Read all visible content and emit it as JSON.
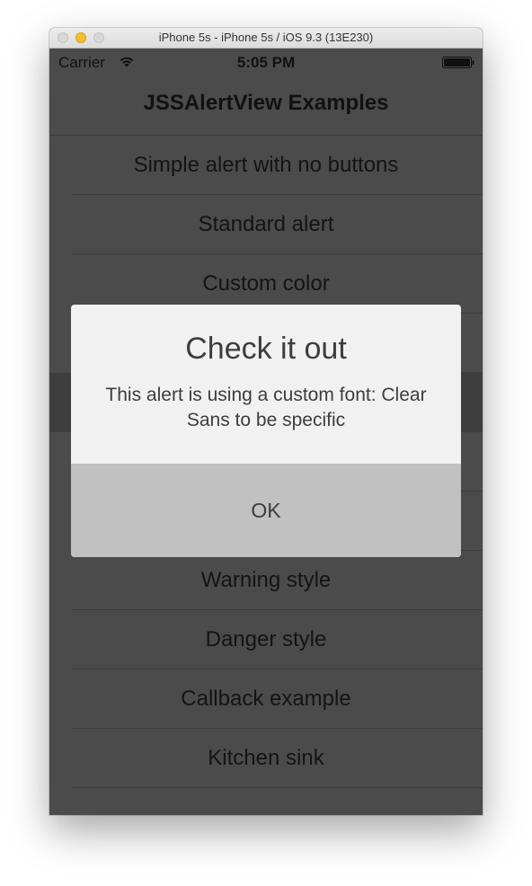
{
  "window": {
    "title": "iPhone 5s - iPhone 5s / iOS 9.3 (13E230)"
  },
  "status_bar": {
    "carrier": "Carrier",
    "time": "5:05 PM",
    "wifi_icon": "wifi-icon",
    "battery_icon": "battery-icon"
  },
  "nav": {
    "title": "JSSAlertView Examples"
  },
  "list": {
    "items": [
      {
        "label": "Simple alert with no buttons"
      },
      {
        "label": "Standard alert"
      },
      {
        "label": "Custom color"
      },
      {
        "label": ""
      },
      {
        "label": ""
      },
      {
        "label": ""
      },
      {
        "label": ""
      },
      {
        "label": "Warning style"
      },
      {
        "label": "Danger style"
      },
      {
        "label": "Callback example"
      },
      {
        "label": "Kitchen sink"
      }
    ]
  },
  "alert": {
    "title": "Check it out",
    "message": "This alert is using a custom font: Clear Sans to be specific",
    "button_label": "OK"
  },
  "colors": {
    "overlay": "#4b4b4b",
    "alert_background": "#f0f1f0",
    "alert_button": "#c0c1c0",
    "text": "#3d3d3d"
  }
}
